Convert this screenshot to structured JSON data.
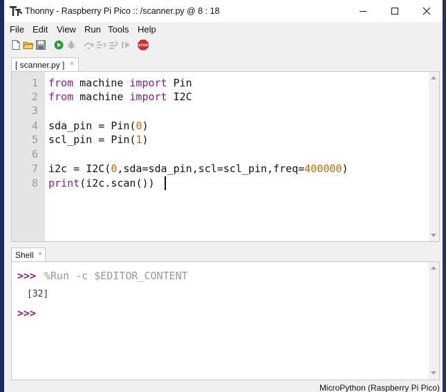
{
  "window": {
    "app_name": "Thonny",
    "title": "Thonny  -  Raspberry Pi Pico :: /scanner.py  @  8 : 18"
  },
  "menu": [
    "File",
    "Edit",
    "View",
    "Run",
    "Tools",
    "Help"
  ],
  "toolbar": {
    "buttons": [
      "new-file",
      "open-file",
      "save-file",
      "run",
      "debug",
      "step-over",
      "step-into",
      "step-out",
      "resume",
      "stop"
    ],
    "stop_label": "STOP"
  },
  "editor": {
    "tab_label": "[ scanner.py ]",
    "tab_close": "×",
    "line_numbers": [
      "1",
      "2",
      "3",
      "4",
      "5",
      "6",
      "7",
      "8"
    ],
    "lines": [
      "from machine import Pin",
      "from machine import I2C",
      "",
      "sda_pin = Pin(0)",
      "scl_pin = Pin(1)",
      "",
      "i2c = I2C(0,sda=sda_pin,scl=scl_pin,freq=400000)",
      "print(i2c.scan())"
    ]
  },
  "shell": {
    "tab_label": "Shell",
    "tab_close": "×",
    "prompt": ">>>",
    "command": "%Run -c $EDITOR_CONTENT",
    "output": "[32]"
  },
  "status": {
    "interpreter": "MicroPython (Raspberry Pi Pico)"
  },
  "colors": {
    "keyword": "#8a1c8a",
    "number": "#c26a00",
    "prompt": "#8a1c8a",
    "gutter": "#e4e4e4"
  }
}
